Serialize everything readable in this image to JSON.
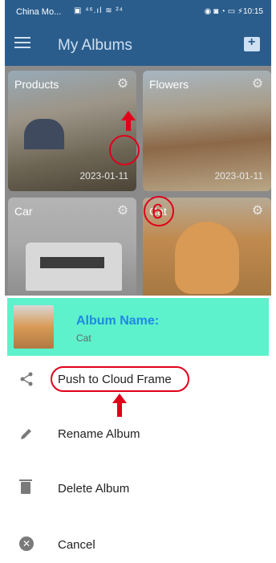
{
  "status_bar": {
    "carrier": "China Mo...",
    "indicators": "▣ ⁴⁶.ıl ≋ ²⁴",
    "right": "◉ ◙ ◔ ▭ ⚡10:15"
  },
  "app_bar": {
    "title": "My Albums",
    "menu_icon": "hamburger-icon",
    "add_icon": "add-album-icon"
  },
  "albums": [
    {
      "name": "Products",
      "date": "2023-01-11"
    },
    {
      "name": "Flowers",
      "date": "2023-01-11"
    },
    {
      "name": "Car"
    },
    {
      "name": "Cat"
    }
  ],
  "annotation": {
    "step_number": "6"
  },
  "sheet": {
    "header": {
      "title": "Album Name:",
      "subtitle": "Cat",
      "background": "#5df1cc",
      "title_color": "#1e88e5"
    },
    "items": [
      {
        "label": "Push to Cloud Frame",
        "icon": "share-icon"
      },
      {
        "label": "Rename Album",
        "icon": "pencil-icon"
      },
      {
        "label": "Delete Album",
        "icon": "trash-icon"
      },
      {
        "label": "Cancel",
        "icon": "cancel-icon"
      }
    ]
  },
  "colors": {
    "annotation_red": "#e0001b",
    "appbar": "#2a5d8c"
  }
}
